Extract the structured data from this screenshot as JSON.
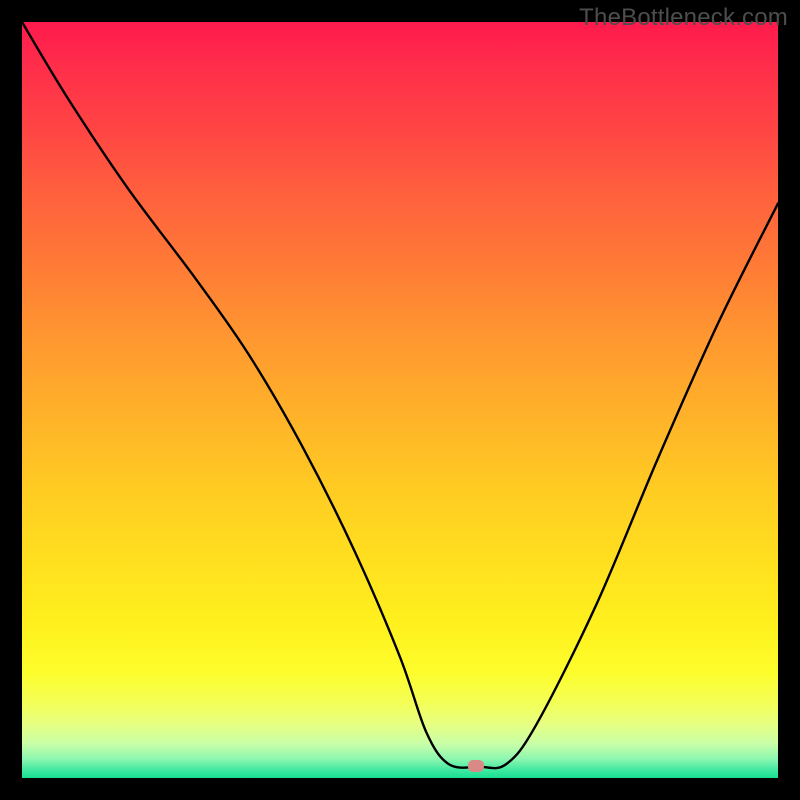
{
  "watermark": "TheBottleneck.com",
  "chart_data": {
    "type": "line",
    "title": "",
    "xlabel": "",
    "ylabel": "",
    "xlim": [
      0,
      100
    ],
    "ylim": [
      0,
      100
    ],
    "grid": false,
    "legend": false,
    "series": [
      {
        "name": "curve",
        "x": [
          0,
          6,
          14,
          23,
          30,
          37,
          44,
          50,
          53.5,
          56.5,
          60.5,
          64,
          68,
          76,
          84,
          92,
          100
        ],
        "values": [
          100,
          90,
          78,
          66,
          56,
          44,
          30,
          16,
          6,
          1.8,
          1.5,
          1.8,
          7,
          23,
          42,
          60,
          76
        ]
      }
    ],
    "marker": {
      "x": 60,
      "y": 1.6
    },
    "background": {
      "type": "vertical-gradient",
      "stops": [
        {
          "pct": 0,
          "color": "#ff1a4d"
        },
        {
          "pct": 42,
          "color": "#ff9830"
        },
        {
          "pct": 72,
          "color": "#ffe11f"
        },
        {
          "pct": 90,
          "color": "#f4ff56"
        },
        {
          "pct": 97,
          "color": "#8cf7b0"
        },
        {
          "pct": 100,
          "color": "#17df92"
        }
      ]
    }
  }
}
